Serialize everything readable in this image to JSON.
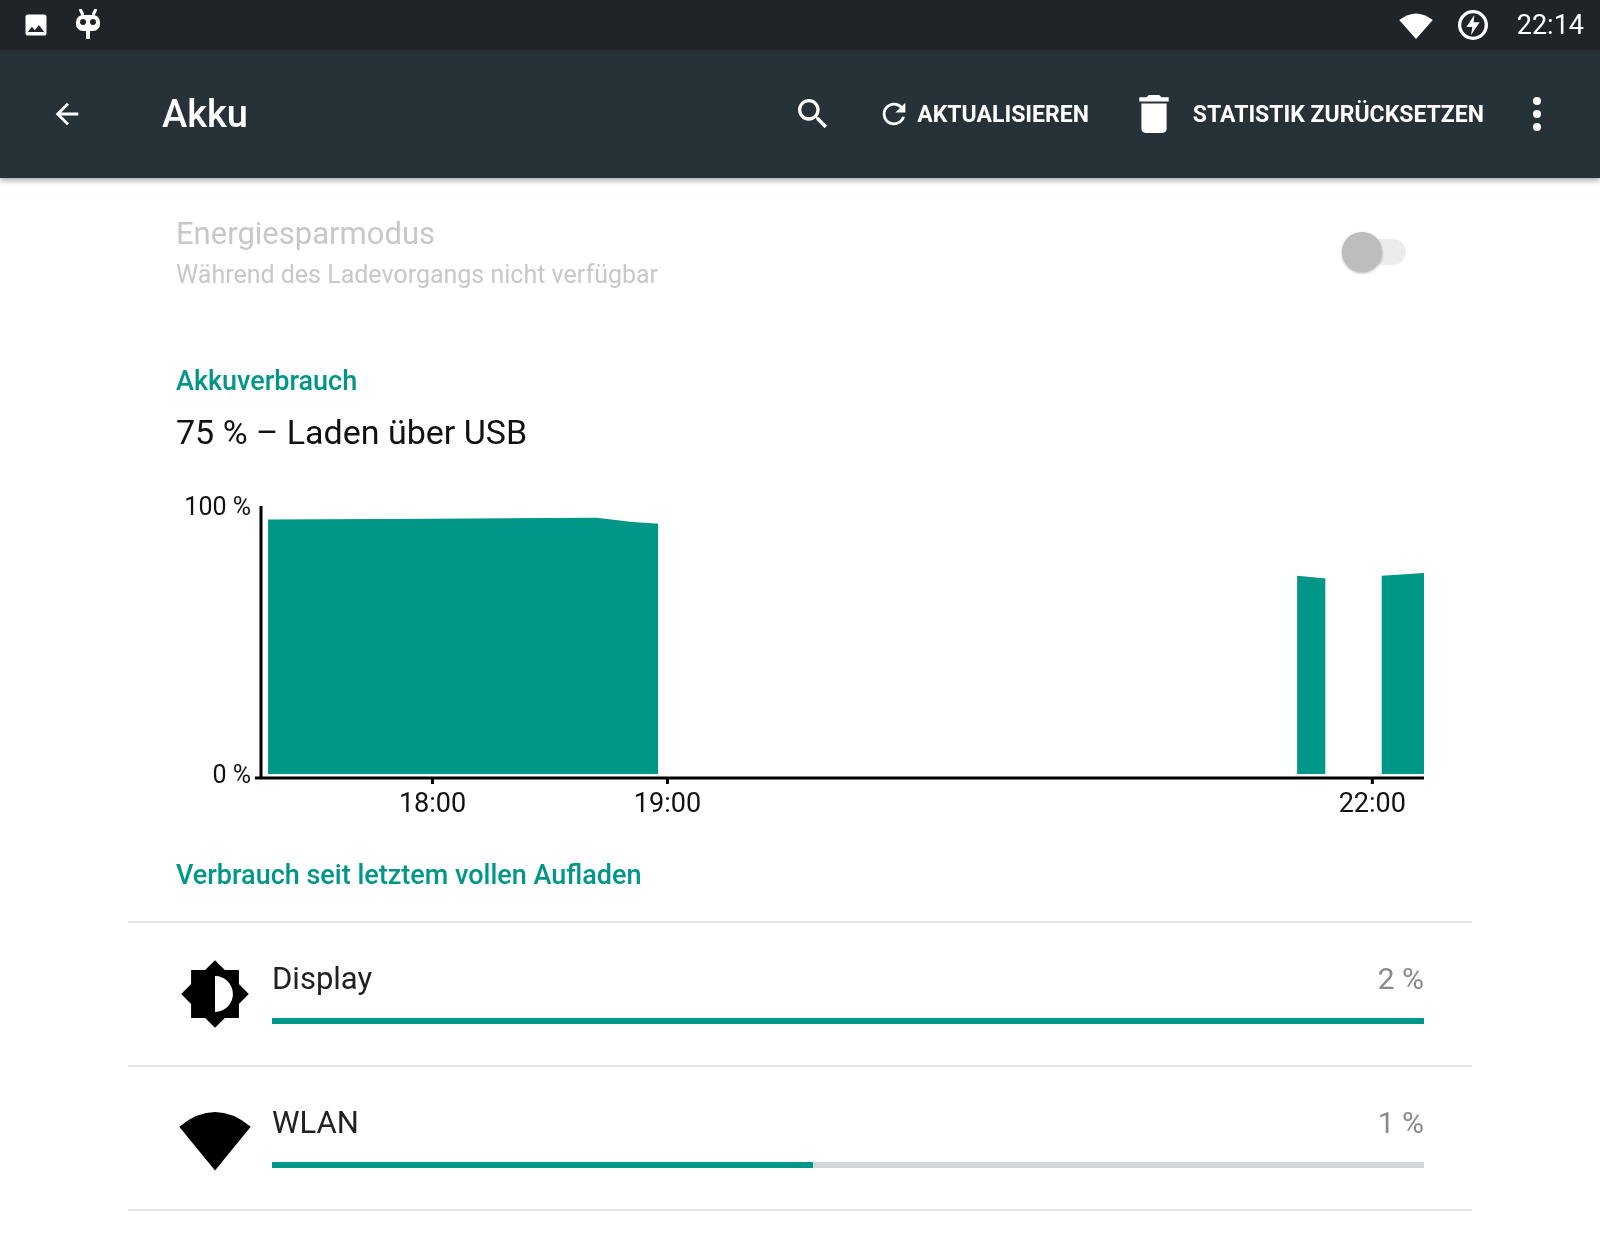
{
  "status_bar": {
    "time": "22:14"
  },
  "toolbar": {
    "title": "Akku",
    "actions": [
      {
        "kind": "refresh",
        "label": "AKTUALISIEREN"
      },
      {
        "kind": "delete",
        "label": "STATISTIK ZURÜCKSETZEN"
      }
    ]
  },
  "power_saver": {
    "title": "Energiesparmodus",
    "subtitle": "Während des Ladevorgangs nicht verfügbar",
    "on": false,
    "disabled": true
  },
  "battery": {
    "header": "Akkuverbrauch",
    "status": "75 % – Laden über USB",
    "chart_data": {
      "type": "area",
      "x": [
        17.3,
        18.0,
        18.5,
        18.7,
        18.85,
        18.95,
        18.96,
        21.68,
        21.79,
        21.8,
        22.04,
        22.22
      ],
      "series": [
        {
          "color": "#009688",
          "values": [
            95,
            95.2,
            95.5,
            95.6,
            94,
            93.5,
            null,
            74,
            73,
            null,
            74,
            75
          ]
        }
      ],
      "xlim": [
        17.27,
        22.22
      ],
      "ylim": [
        0,
        100
      ],
      "xticks": [
        {
          "value": 18,
          "label": "18:00"
        },
        {
          "value": 19,
          "label": "19:00"
        },
        {
          "value": 22,
          "label": "22:00"
        }
      ],
      "yticks": [
        {
          "value": 0,
          "label": "0 %"
        },
        {
          "value": 100,
          "label": "100 %"
        }
      ]
    }
  },
  "usage": {
    "header": "Verbrauch seit letztem vollen Aufladen",
    "items": [
      {
        "kind": "display",
        "name": "Display",
        "percent": "2 %",
        "level": 1.0
      },
      {
        "kind": "wifi",
        "name": "WLAN",
        "percent": "1 %",
        "level": 0.47
      }
    ]
  }
}
